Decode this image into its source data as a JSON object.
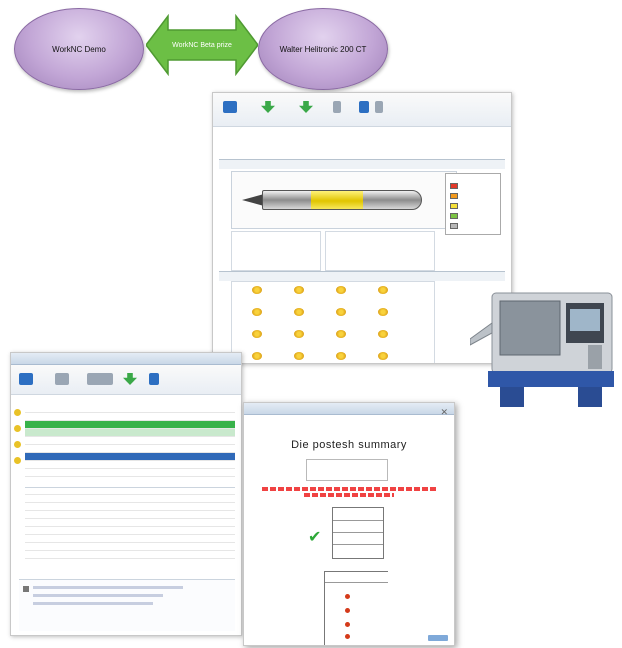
{
  "diagram": {
    "left_node_label": "WorkNC Demo",
    "arrow_label": "WorkNC Beta prize",
    "right_node_label": "Walter Helitronic 200 CT",
    "node_caption": "",
    "colors": {
      "node_fill": "#c2a6d6",
      "arrow_fill": "#6cbf45"
    }
  },
  "tool_editor": {
    "title": "",
    "legend_colors": [
      "#e23a2a",
      "#f29a1e",
      "#f5e03a",
      "#7cc444",
      "#b7b7b7"
    ],
    "icons": [
      "download-icon",
      "upload-icon",
      "blue-square-icon",
      "gear-icon"
    ]
  },
  "program_list": {
    "row_count": 16,
    "highlight_row_color": "#38b24a",
    "selected_row_color": "#2f69b8"
  },
  "post_summary": {
    "title": "Die postesh summary",
    "check_icon": "checkmark-icon",
    "ok_color": "#7fa9d9"
  }
}
